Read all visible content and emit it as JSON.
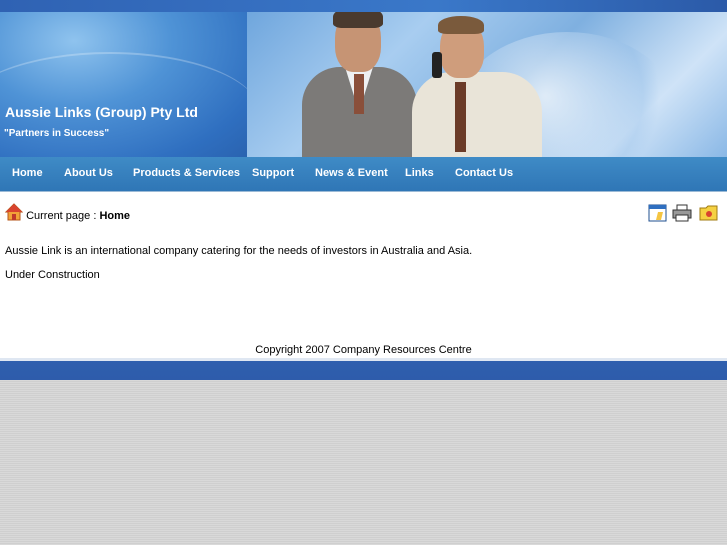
{
  "header": {
    "company_name": "Aussie Links (Group) Pty Ltd",
    "slogan": "\"Partners in Success\""
  },
  "nav": {
    "items": [
      "Home",
      "About Us",
      "Products & Services",
      "Support",
      "News & Event",
      "Links",
      "Contact Us"
    ]
  },
  "breadcrumb": {
    "prefix": "Current page : ",
    "current": "Home"
  },
  "toolbar": {
    "icons": [
      "calendar-icon",
      "printer-icon",
      "folder-icon"
    ]
  },
  "content": {
    "intro": "Aussie Link is an international company catering for the needs of investors in Australia and Asia.",
    "status": "Under Construction"
  },
  "footer": {
    "copyright": "Copyright 2007 Company Resources Centre"
  },
  "colors": {
    "nav_bg": "#2f76b6",
    "banner_blue": "#2f6fc0",
    "footer_bar": "#2f5fae"
  }
}
